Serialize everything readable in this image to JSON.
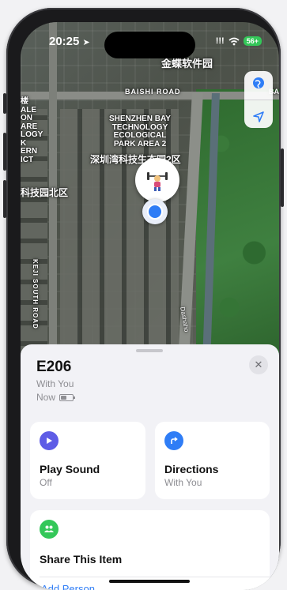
{
  "status_bar": {
    "time": "20:25",
    "signal": "!!!",
    "battery": "56+"
  },
  "map": {
    "labels": {
      "top_building": "金蝶软件园",
      "road_baishi": "BAISHI ROAD",
      "park_en": "SHENZHEN BAY\nTECHNOLOGY\nECOLOGICAL\nPARK AREA 2",
      "park_cn": "深圳湾科技生态园2区",
      "north_cn": "科技园北区",
      "left_cut": "楼\nALE\nON\nARE\nLOGY\nK\nERN\nICT",
      "keji_road": "KEJI SOUTH ROAD",
      "dashaho": "Dashaho",
      "top_right_cut": "BA"
    }
  },
  "sheet": {
    "title": "E206",
    "subtitle": "With You",
    "now_label": "Now",
    "battery_level": 0.5,
    "cards": {
      "play_sound": {
        "label": "Play Sound",
        "sub": "Off"
      },
      "directions": {
        "label": "Directions",
        "sub": "With You"
      },
      "share": {
        "label": "Share This Item",
        "action": "Add Person"
      }
    }
  },
  "colors": {
    "accent_blue": "#2f7df6",
    "play_purple": "#5e5ce6",
    "share_green": "#34c759"
  }
}
